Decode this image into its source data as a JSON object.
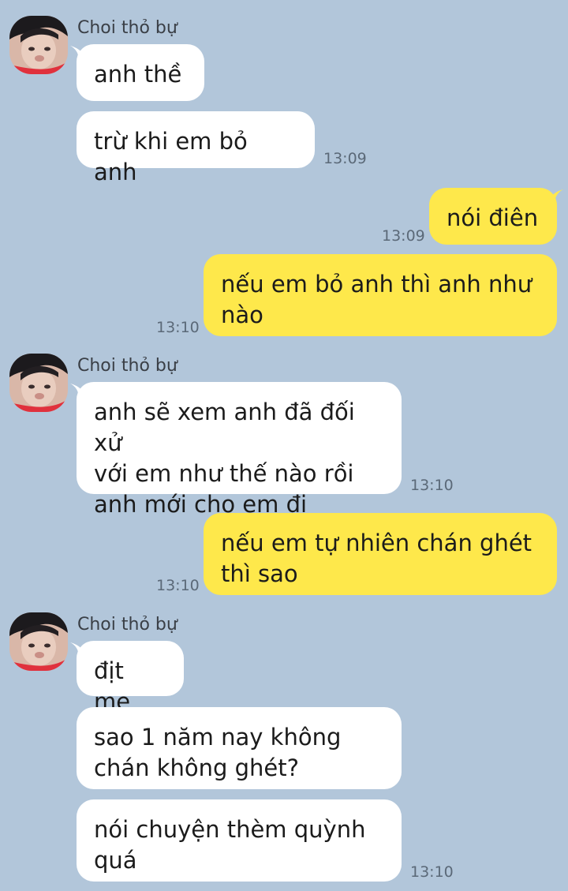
{
  "contact": {
    "name": "Choi thỏ bự"
  },
  "messages": [
    {
      "direction": "in",
      "text": "anh thề",
      "time": ""
    },
    {
      "direction": "in",
      "text": "trừ khi em bỏ anh",
      "time": "13:09"
    },
    {
      "direction": "out",
      "text": "nói điên",
      "time": "13:09"
    },
    {
      "direction": "out",
      "text": "nếu em bỏ anh thì anh như\nnào",
      "time": "13:10"
    },
    {
      "direction": "in",
      "text": "anh sẽ xem anh đã đối xử\nvới em như thế nào rồi\nanh mới cho em đi",
      "time": "13:10"
    },
    {
      "direction": "out",
      "text": "nếu em tự nhiên chán ghét\nthì sao",
      "time": "13:10"
    },
    {
      "direction": "in",
      "text": "địt mẹ",
      "time": ""
    },
    {
      "direction": "in",
      "text": "sao 1 năm nay không\nchán không ghét?",
      "time": ""
    },
    {
      "direction": "in",
      "text": "nói chuyện thèm quỳnh\nquá",
      "time": "13:10"
    }
  ],
  "colors": {
    "background": "#b2c6da",
    "incoming_bubble": "#ffffff",
    "outgoing_bubble": "#fee84b"
  }
}
